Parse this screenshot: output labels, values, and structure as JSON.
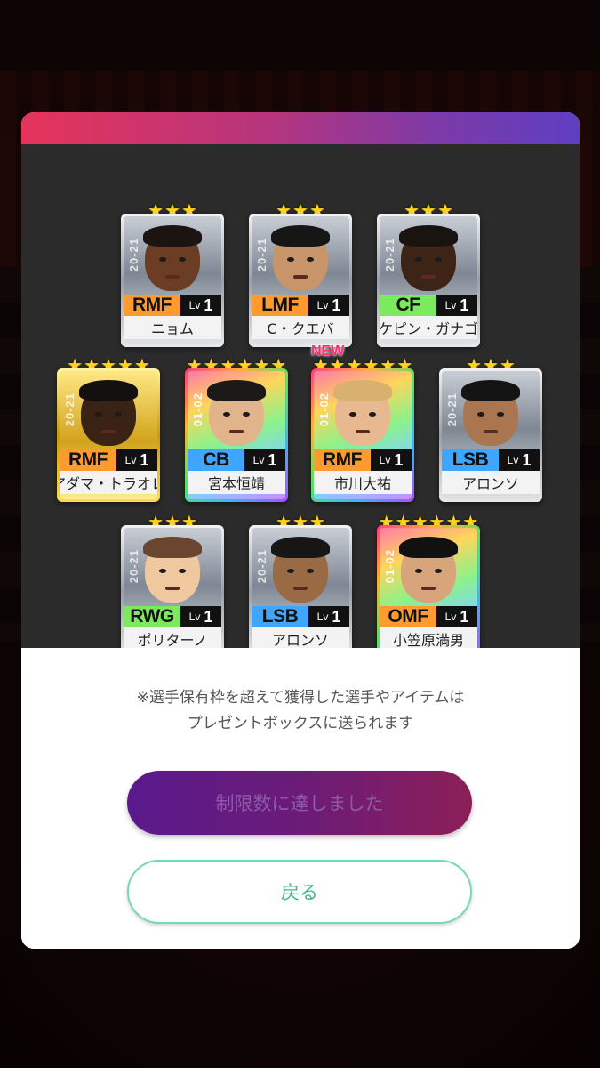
{
  "notice": {
    "line1": "※選手保有枠を超えて獲得した選手やアイテムは",
    "line2": "プレゼントボックスに送られます"
  },
  "buttons": {
    "limit_label": "制限数に達しました",
    "back_label": "戻る"
  },
  "cards": [
    {
      "position": "RMF",
      "level_prefix": "Lv",
      "level": "1",
      "name": "ニョム",
      "season": "20-21",
      "rarity": "silver",
      "stars": 3,
      "pos_color": "#ff9a2e",
      "new": false
    },
    {
      "position": "LMF",
      "level_prefix": "Lv",
      "level": "1",
      "name": "C・クエバ",
      "season": "20-21",
      "rarity": "silver",
      "stars": 3,
      "pos_color": "#ff9a2e",
      "new": false
    },
    {
      "position": "CF",
      "level_prefix": "Lv",
      "level": "1",
      "name": "ケピン・ガナゴ",
      "season": "20-21",
      "rarity": "silver",
      "stars": 3,
      "pos_color": "#7bea5c",
      "new": false
    },
    {
      "position": "RMF",
      "level_prefix": "Lv",
      "level": "1",
      "name": "アダマ・トラオレ",
      "season": "20-21",
      "rarity": "gold",
      "stars": 5,
      "pos_color": "#ff9a2e",
      "new": false
    },
    {
      "position": "CB",
      "level_prefix": "Lv",
      "level": "1",
      "name": "宮本恒靖",
      "season": "01-02",
      "rarity": "rainbow",
      "stars": 6,
      "pos_color": "#3ea6ff",
      "new": false
    },
    {
      "position": "RMF",
      "level_prefix": "Lv",
      "level": "1",
      "name": "市川大祐",
      "season": "01-02",
      "rarity": "rainbow",
      "stars": 6,
      "pos_color": "#ff9a2e",
      "new": true,
      "new_label": "NEW"
    },
    {
      "position": "LSB",
      "level_prefix": "Lv",
      "level": "1",
      "name": "アロンソ",
      "season": "20-21",
      "rarity": "silver",
      "stars": 3,
      "pos_color": "#3ea6ff",
      "new": false
    },
    {
      "position": "RWG",
      "level_prefix": "Lv",
      "level": "1",
      "name": "ポリターノ",
      "season": "20-21",
      "rarity": "silver",
      "stars": 3,
      "pos_color": "#7bea5c",
      "new": false
    },
    {
      "position": "LSB",
      "level_prefix": "Lv",
      "level": "1",
      "name": "アロンソ",
      "season": "20-21",
      "rarity": "silver",
      "stars": 3,
      "pos_color": "#3ea6ff",
      "new": false
    },
    {
      "position": "OMF",
      "level_prefix": "Lv",
      "level": "1",
      "name": "小笠原満男",
      "season": "01-02",
      "rarity": "rainbow",
      "stars": 6,
      "pos_color": "#ff9a2e",
      "new": false
    }
  ],
  "colors": {
    "header_gradient": [
      "#e5345a",
      "#5e3fc2"
    ],
    "card_area_bg": "#2b2b2b",
    "back_button_accent": "#3cb98a"
  }
}
